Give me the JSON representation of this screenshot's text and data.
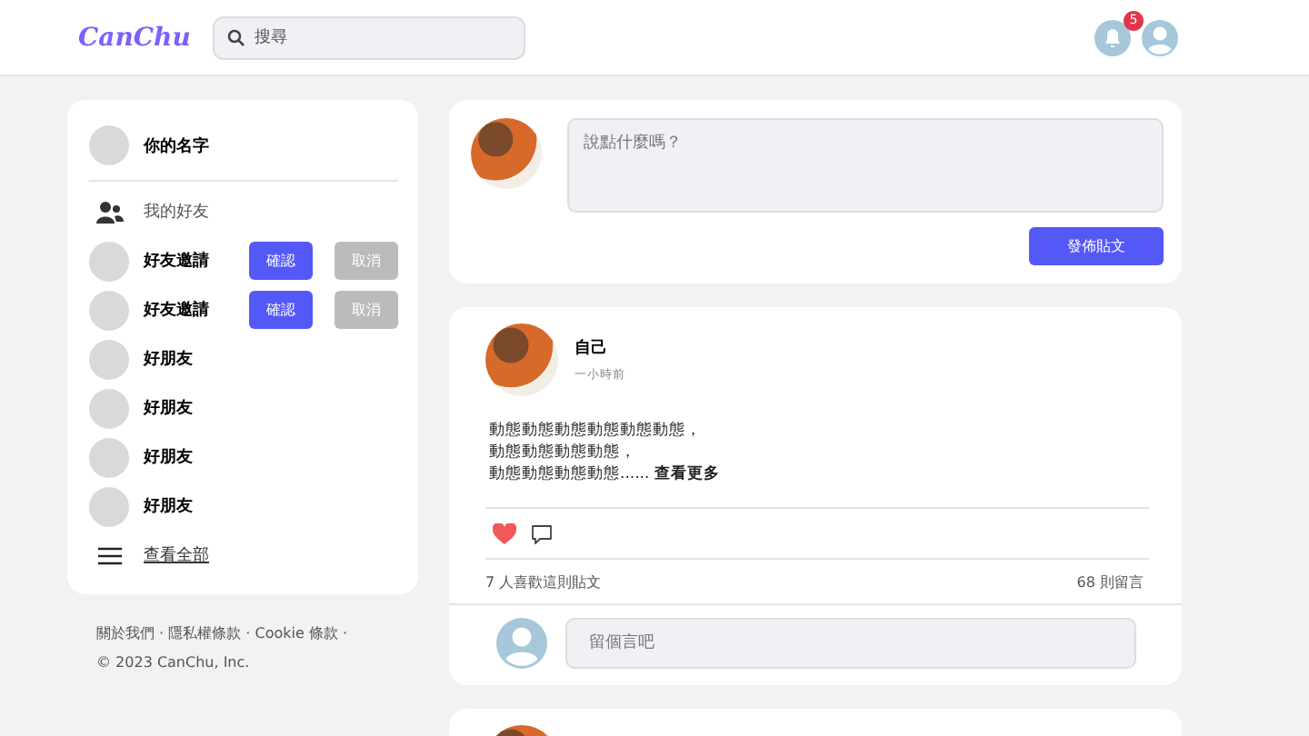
{
  "header": {
    "logo": "CanChu",
    "search": {
      "placeholder": "搜尋"
    },
    "notification_count": "5"
  },
  "sidebar": {
    "profile_name": "你的名字",
    "section_title": "我的好友",
    "friends": [
      {
        "kind": "request",
        "name": "好友邀請",
        "confirm": "確認",
        "cancel": "取消"
      },
      {
        "kind": "request",
        "name": "好友邀請",
        "confirm": "確認",
        "cancel": "取消"
      },
      {
        "kind": "friend",
        "name": "好朋友"
      },
      {
        "kind": "friend",
        "name": "好朋友"
      },
      {
        "kind": "friend",
        "name": "好朋友"
      },
      {
        "kind": "friend",
        "name": "好朋友"
      }
    ],
    "see_all": "查看全部"
  },
  "footer": {
    "links": "關於我們 · 隱私權條款 · Cookie 條款 ·",
    "copyright": "© 2023 CanChu, Inc."
  },
  "composer": {
    "placeholder": "說點什麼嗎？",
    "button": "發佈貼文"
  },
  "posts": [
    {
      "author": "自己",
      "time": "一小時前",
      "body": [
        "動態動態動態動態動態動態，",
        "動態動態動態動態，",
        "動態動態動態動態...... **查看更多**"
      ],
      "liked": true,
      "likes": "7 人喜歡這則貼文",
      "comments": "68 則留言",
      "comment_placeholder": "留個言吧"
    }
  ]
}
